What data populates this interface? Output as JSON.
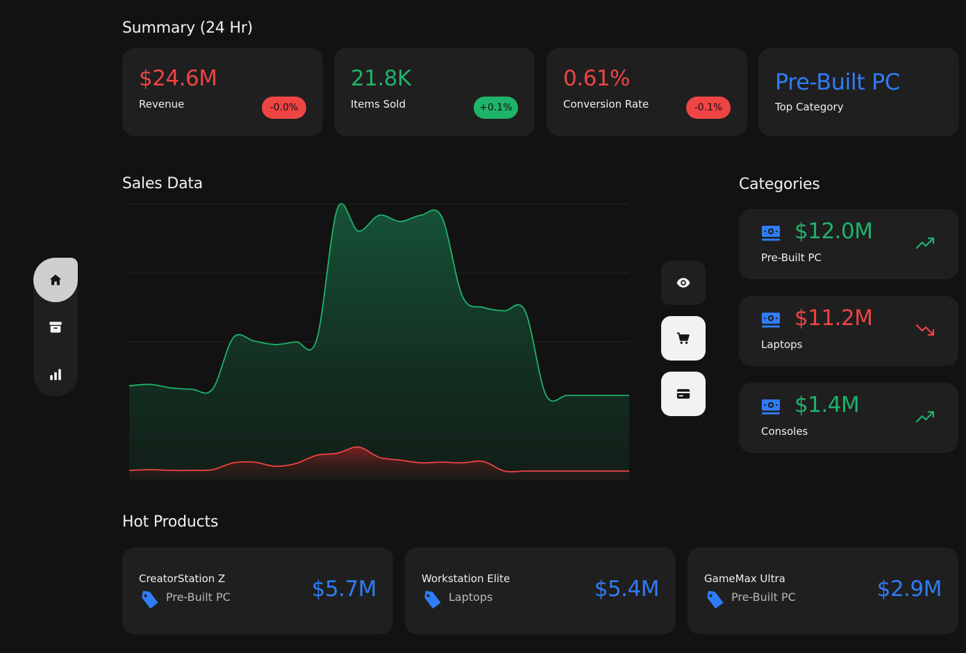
{
  "colors": {
    "background": "#121212",
    "card": "#1f1f1f",
    "positive": "#1fb36b",
    "negative": "#ef4444",
    "accent_blue": "#2f7cf6"
  },
  "sidebar": {
    "items": [
      {
        "name": "home",
        "icon": "home-icon",
        "active": true
      },
      {
        "name": "archive",
        "icon": "archive-icon",
        "active": false
      },
      {
        "name": "analytics",
        "icon": "bar-chart-icon",
        "active": false
      }
    ]
  },
  "summary": {
    "title": "Summary (24 Hr)",
    "cards": [
      {
        "value": "$24.6M",
        "label": "Revenue",
        "badge": "-0.0%",
        "trend": "negative"
      },
      {
        "value": "21.8K",
        "label": "Items Sold",
        "badge": "+0.1%",
        "trend": "positive"
      },
      {
        "value": "0.61%",
        "label": "Conversion Rate",
        "badge": "-0.1%",
        "trend": "negative"
      },
      {
        "value": "Pre-Built PC",
        "label": "Top Category"
      }
    ]
  },
  "sales": {
    "title": "Sales Data",
    "toggles": [
      {
        "icon": "eye-icon",
        "active": false
      },
      {
        "icon": "cart-icon",
        "active": true
      },
      {
        "icon": "credit-card-icon",
        "active": true
      }
    ]
  },
  "chart_data": {
    "type": "area",
    "title": "Sales Data",
    "ylim": [
      0,
      4
    ],
    "grid": true,
    "x": [
      0,
      1,
      2,
      3,
      4,
      5,
      6,
      7,
      8,
      9,
      10,
      11,
      12,
      13,
      14,
      15,
      16,
      17,
      18,
      19,
      20,
      21,
      22,
      23,
      24
    ],
    "series": [
      {
        "color": "#1fb36b",
        "values": [
          1.36,
          1.38,
          1.33,
          1.31,
          1.31,
          2.06,
          2.01,
          1.96,
          2.0,
          2.03,
          3.94,
          3.61,
          3.84,
          3.75,
          3.84,
          3.82,
          2.66,
          2.5,
          2.45,
          2.45,
          1.23,
          1.22,
          1.22,
          1.22,
          1.22
        ]
      },
      {
        "color": "#ef4444",
        "values": [
          0.13,
          0.14,
          0.13,
          0.13,
          0.14,
          0.24,
          0.25,
          0.19,
          0.23,
          0.35,
          0.38,
          0.47,
          0.32,
          0.28,
          0.24,
          0.25,
          0.24,
          0.26,
          0.12,
          0.12,
          0.12,
          0.12,
          0.12,
          0.12,
          0.12
        ]
      }
    ]
  },
  "categories": {
    "title": "Categories",
    "items": [
      {
        "value": "$12.0M",
        "label": "Pre-Built PC",
        "trend": "up"
      },
      {
        "value": "$11.2M",
        "label": "Laptops",
        "trend": "down"
      },
      {
        "value": "$1.4M",
        "label": "Consoles",
        "trend": "up"
      }
    ]
  },
  "hot_products": {
    "title": "Hot Products",
    "items": [
      {
        "name": "CreatorStation Z",
        "category": "Pre-Built PC",
        "price": "$5.7M"
      },
      {
        "name": "Workstation Elite",
        "category": "Laptops",
        "price": "$5.4M"
      },
      {
        "name": "GameMax Ultra",
        "category": "Pre-Built PC",
        "price": "$2.9M"
      }
    ]
  }
}
